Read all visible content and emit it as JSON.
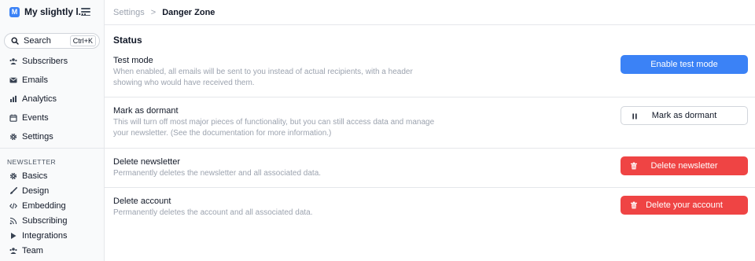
{
  "app": {
    "brand_initial": "M",
    "brand_name": "My slightly l..."
  },
  "sidebar": {
    "search_label": "Search",
    "search_shortcut": "Ctrl+K",
    "main_items": [
      {
        "label": "Subscribers",
        "icon": "users-icon"
      },
      {
        "label": "Emails",
        "icon": "envelope-icon"
      },
      {
        "label": "Analytics",
        "icon": "bar-chart-icon"
      },
      {
        "label": "Events",
        "icon": "calendar-icon"
      },
      {
        "label": "Settings",
        "icon": "gear-icon"
      }
    ],
    "section_title": "NEWSLETTER",
    "newsletter_items": [
      {
        "label": "Basics",
        "icon": "gear-icon"
      },
      {
        "label": "Design",
        "icon": "paintbrush-icon"
      },
      {
        "label": "Embedding",
        "icon": "code-icon"
      },
      {
        "label": "Subscribing",
        "icon": "rss-icon"
      },
      {
        "label": "Integrations",
        "icon": "play-icon"
      },
      {
        "label": "Team",
        "icon": "users-icon"
      }
    ]
  },
  "header": {
    "breadcrumb_root": "Settings",
    "breadcrumb_separator": ">",
    "breadcrumb_current": "Danger Zone"
  },
  "main": {
    "section_title": "Status",
    "rows": [
      {
        "title": "Test mode",
        "description": "When enabled, all emails will be sent to you instead of actual recipients, with a header showing who would have received them.",
        "button_label": "Enable test mode",
        "button_style": "primary"
      },
      {
        "title": "Mark as dormant",
        "description": "This will turn off most major pieces of functionality, but you can still access data and manage your newsletter. (See the documentation for more information.)",
        "button_label": "Mark as dormant",
        "button_style": "outline",
        "button_icon": "pause-icon"
      },
      {
        "title": "Delete newsletter",
        "description": "Permanently deletes the newsletter and all associated data.",
        "button_label": "Delete newsletter",
        "button_style": "danger",
        "button_icon": "trash-icon"
      },
      {
        "title": "Delete account",
        "description": "Permanently deletes the account and all associated data.",
        "button_label": "Delete your account",
        "button_style": "danger",
        "button_icon": "trash-icon"
      }
    ]
  },
  "colors": {
    "primary": "#3b82f6",
    "danger": "#ef4444",
    "muted_text": "#9ca3af",
    "border": "#e5e7eb",
    "sidebar_bg": "#f9fafb"
  }
}
